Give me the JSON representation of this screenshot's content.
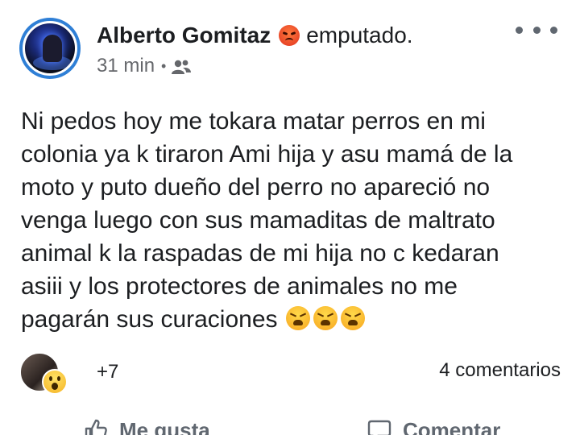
{
  "post": {
    "author": "Alberto Gomitaz",
    "feeling": "emputado.",
    "feeling_emoji": "angry-face-icon",
    "time": "31 min",
    "separator": "•",
    "audience_icon": "friends-icon",
    "lines": [
      "Ni pedos hoy me tokara matar perros en mi",
      "colonia ya k tiraron Ami hija y asu mamá de la",
      "moto y puto dueño del perro no apareció no",
      "venga luego con sus mamaditas de maltrato",
      "animal k la raspadas de mi hija no c kedaran",
      "asiii y los protectores de animales no me",
      "pagarán sus curaciones"
    ],
    "trailing_emoji": "tired-face-icon"
  },
  "reactions": {
    "count": "+7",
    "reaction_icon": "wow-face-icon"
  },
  "comments": {
    "label": "4 comentarios"
  },
  "actions": {
    "like_label": "Me gusta",
    "comment_label": "Comentar"
  },
  "colors": {
    "text": "#1c1e21",
    "secondary": "#65676b",
    "avatar_ring": "#2f7fd6"
  }
}
